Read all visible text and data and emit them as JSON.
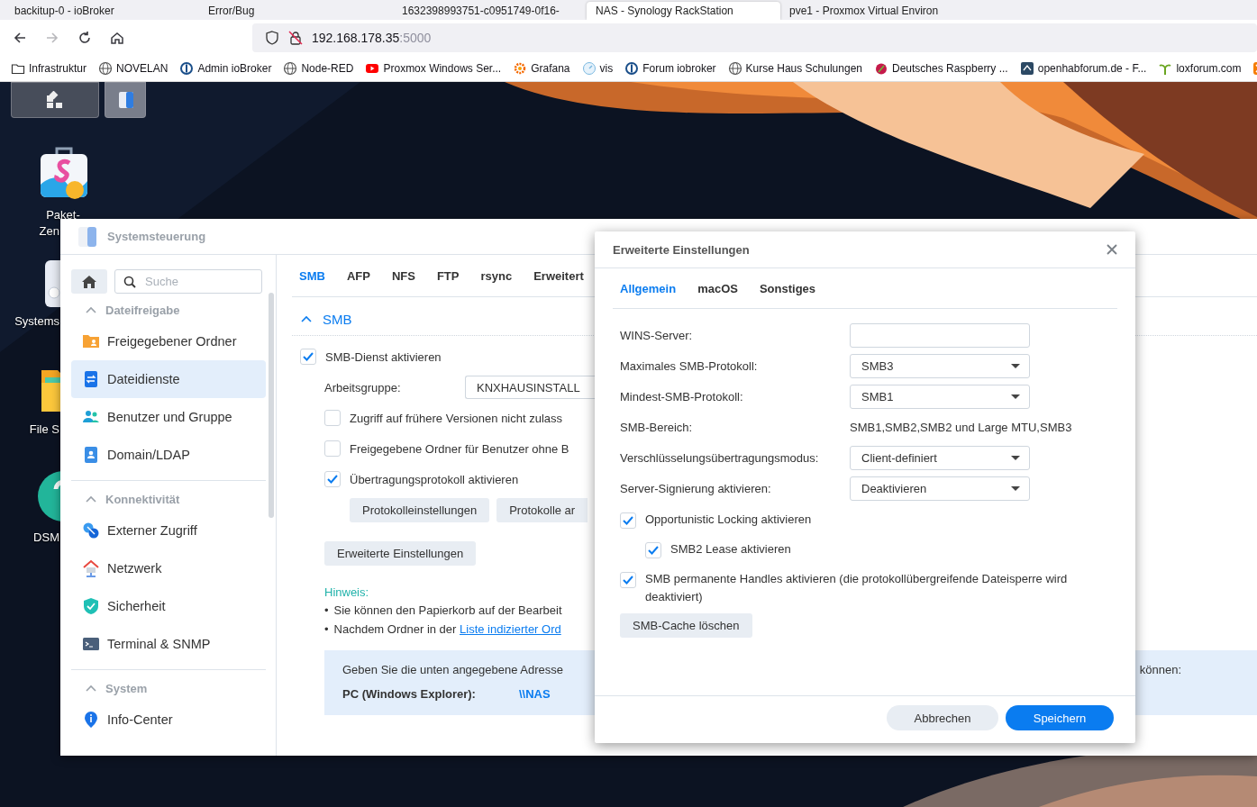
{
  "browser": {
    "tabs": [
      {
        "title": "backitup-0 - ioBroker",
        "selected": false
      },
      {
        "title": "Error/Bug",
        "selected": false
      },
      {
        "title": "1632398993751-c0951749-0f16-",
        "selected": false
      },
      {
        "title": "NAS - Synology RackStation",
        "selected": true
      },
      {
        "title": "pve1 - Proxmox Virtual Environ",
        "selected": false
      }
    ],
    "nav": [
      {
        "kind": "back",
        "disabled": false
      },
      {
        "kind": "forward",
        "disabled": true
      },
      {
        "kind": "reload",
        "disabled": false
      },
      {
        "kind": "home",
        "disabled": false
      }
    ],
    "url": {
      "host": "192.168.178.35",
      "port": ":5000"
    },
    "bookmarks": [
      {
        "label": "Infrastruktur",
        "kind": "folder"
      },
      {
        "label": "NOVELAN",
        "kind": "globe"
      },
      {
        "label": "Admin ioBroker",
        "kind": "ring"
      },
      {
        "label": "Node-RED",
        "kind": "globe"
      },
      {
        "label": "Proxmox Windows Ser...",
        "kind": "play"
      },
      {
        "label": "Grafana",
        "kind": "sun"
      },
      {
        "label": "vis",
        "kind": "gauge"
      },
      {
        "label": "Forum iobroker",
        "kind": "ring"
      },
      {
        "label": "Kurse Haus Schulungen",
        "kind": "globe"
      },
      {
        "label": "Deutsches Raspberry ...",
        "kind": "berry"
      },
      {
        "label": "openhabforum.de - F...",
        "kind": "roof"
      },
      {
        "label": "loxforum.com",
        "kind": "leaf"
      },
      {
        "kind": "cross"
      }
    ]
  },
  "desktop": {
    "taskbar": [
      {
        "kind": "grid",
        "selected": false
      },
      {
        "kind": "panel",
        "selected": true
      }
    ],
    "icons": [
      {
        "label": "Paket-",
        "label_2": "Zen",
        "kind": "package"
      },
      {
        "label": "Systems",
        "kind": "panel"
      },
      {
        "label": "File S",
        "kind": "folder"
      },
      {
        "label": "DSM",
        "kind": "help"
      }
    ]
  },
  "control_panel": {
    "title": "Systemsteuerung",
    "search": {
      "placeholder": "Suche"
    },
    "sidebar": [
      {
        "section": "Dateifreigabe",
        "expanded": true,
        "items": [
          {
            "label": "Freigegebener Ordner",
            "kind": "folder",
            "selected": false
          },
          {
            "label": "Dateidienste",
            "kind": "share",
            "selected": true
          },
          {
            "label": "Benutzer und Gruppe",
            "kind": "users",
            "selected": false
          },
          {
            "label": "Domain/LDAP",
            "kind": "card",
            "selected": false
          }
        ]
      },
      {
        "section": "Konnektivität",
        "expanded": true,
        "items": [
          {
            "label": "Externer Zugriff",
            "kind": "remote",
            "selected": false
          },
          {
            "label": "Netzwerk",
            "kind": "house",
            "selected": false
          },
          {
            "label": "Sicherheit",
            "kind": "shield",
            "selected": false
          },
          {
            "label": "Terminal & SNMP",
            "kind": "terminal",
            "selected": false
          }
        ]
      },
      {
        "section": "System",
        "expanded": true,
        "items": [
          {
            "label": "Info-Center",
            "kind": "info",
            "selected": false
          }
        ]
      }
    ],
    "tabs": [
      {
        "label": "SMB",
        "selected": true
      },
      {
        "label": "AFP",
        "selected": false
      },
      {
        "label": "NFS",
        "selected": false
      },
      {
        "label": "FTP",
        "selected": false
      },
      {
        "label": "rsync",
        "selected": false
      },
      {
        "label": "Erweitert",
        "selected": false
      }
    ],
    "section": {
      "title": "SMB",
      "expanded": true
    },
    "enable": {
      "label": "SMB-Dienst aktivieren",
      "checked": true
    },
    "workgroup": {
      "label": "Arbeitsgruppe:",
      "value": "KNXHAUSINSTALL"
    },
    "options": [
      {
        "label": "Zugriff auf frühere Versionen nicht zulass",
        "checked": false
      },
      {
        "label": "Freigegebene Ordner für Benutzer ohne B",
        "checked": false
      },
      {
        "label": "Übertragungsprotokoll aktivieren",
        "checked": true
      }
    ],
    "protocol_buttons": [
      "Protokolleinstellungen",
      "Protokolle ar"
    ],
    "advanced_button": "Erweiterte Einstellungen",
    "hint": {
      "title": "Hinweis:",
      "lines": [
        {
          "bullet": "•",
          "text": "Sie können den Papierkorb auf der Bearbeit"
        },
        {
          "bullet": "•",
          "text": "Nachdem Ordner in der ",
          "link": "Liste indizierter Ord"
        }
      ]
    },
    "address_box": {
      "intro": "Geben Sie die unten angegebene Adresse",
      "intro_end": "können:",
      "label": "PC (Windows Explorer):",
      "value": "\\\\NAS"
    }
  },
  "dialog": {
    "title": "Erweiterte Einstellungen",
    "tabs": [
      {
        "label": "Allgemein",
        "selected": true
      },
      {
        "label": "macOS",
        "selected": false
      },
      {
        "label": "Sonstiges",
        "selected": false
      }
    ],
    "fields": [
      {
        "kind": "text",
        "label": "WINS-Server:"
      },
      {
        "kind": "select",
        "label": "Maximales SMB-Protokoll:",
        "value": "SMB3"
      },
      {
        "kind": "select",
        "label": "Mindest-SMB-Protokoll:",
        "value": "SMB1"
      },
      {
        "kind": "static",
        "label": "SMB-Bereich:",
        "value": "SMB1,SMB2,SMB2 und Large MTU,SMB3"
      },
      {
        "kind": "select",
        "label": "Verschlüsselungsübertragungsmodus:",
        "value": "Client-definiert"
      },
      {
        "kind": "select",
        "label": "Server-Signierung aktivieren:",
        "value": "Deaktivieren"
      }
    ],
    "checks": [
      {
        "label": "Opportunistic Locking aktivieren",
        "checked": true,
        "children": [
          {
            "label": "SMB2 Lease aktivieren",
            "checked": true
          }
        ]
      },
      {
        "label": "SMB permanente Handles aktivieren (die protokollübergreifende Dateisperre wird deaktiviert)",
        "checked": true
      }
    ],
    "action": "SMB-Cache löschen",
    "buttons": [
      {
        "label": "Abbrechen",
        "kind": "secondary"
      },
      {
        "label": "Speichern",
        "kind": "primary"
      }
    ]
  }
}
